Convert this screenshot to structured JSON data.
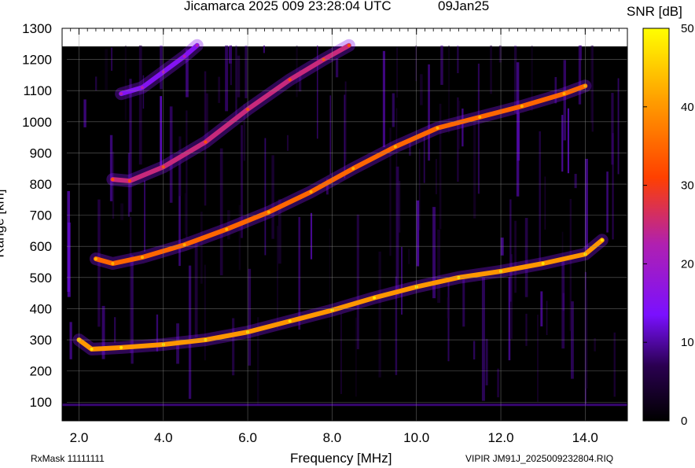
{
  "header": {
    "title": "Jicamarca 2025 009 23:28:04 UTC",
    "date": "09Jan25"
  },
  "footer": {
    "rxmask": "RxMask 11111111",
    "filename": "VIPIR  JM91J_2025009232804.RIQ"
  },
  "colorbar": {
    "label": "SNR [dB]",
    "min": 0,
    "max": 50,
    "ticks": [
      0,
      10,
      20,
      30,
      40,
      50
    ],
    "colors": [
      "#000000",
      "#2a0050",
      "#7a10ff",
      "#b020b0",
      "#ff4000",
      "#ffa000",
      "#ffff00"
    ]
  },
  "chart_data": {
    "type": "heatmap",
    "title": "Jicamarca 2025 009 23:28:04 UTC",
    "xlabel": "Frequency [MHz]",
    "ylabel": "Range [km]",
    "xlim": [
      1.6,
      15.0
    ],
    "ylim": [
      40,
      1300
    ],
    "x_ticks": [
      "2.0",
      "4.0",
      "6.0",
      "8.0",
      "10.0",
      "12.0",
      "14.0"
    ],
    "x_tick_values": [
      2,
      4,
      6,
      8,
      10,
      12,
      14
    ],
    "y_ticks": [
      100,
      200,
      300,
      400,
      500,
      600,
      700,
      800,
      900,
      1000,
      1100,
      1200,
      1300
    ],
    "grid": true,
    "colorscale": "SNR [dB]",
    "traces": [
      {
        "name": "",
        "x": [
          2.0,
          2.3,
          3.0,
          4.0,
          5.0,
          6.0,
          7.0,
          8.0,
          9.0,
          10.0,
          11.0,
          12.0,
          13.0,
          14.0,
          14.4
        ],
        "y": [
          300,
          270,
          275,
          285,
          300,
          325,
          360,
          395,
          435,
          470,
          500,
          520,
          545,
          575,
          620
        ],
        "snr": 40
      },
      {
        "name": "",
        "x": [
          2.4,
          2.8,
          3.5,
          4.5,
          5.5,
          6.5,
          7.5,
          8.5,
          9.5,
          10.5,
          11.5,
          12.5,
          13.5,
          14.0
        ],
        "y": [
          560,
          545,
          565,
          605,
          655,
          710,
          775,
          850,
          920,
          980,
          1015,
          1050,
          1090,
          1115
        ],
        "snr": 35
      },
      {
        "name": "",
        "x": [
          2.8,
          3.2,
          4.0,
          5.0,
          6.0,
          7.0,
          7.8,
          8.4
        ],
        "y": [
          815,
          810,
          855,
          935,
          1040,
          1135,
          1200,
          1245
        ],
        "snr": 25
      },
      {
        "name": "",
        "x": [
          3.0,
          3.5,
          4.0,
          4.5,
          4.8
        ],
        "y": [
          1090,
          1110,
          1160,
          1210,
          1245
        ],
        "snr": 15
      }
    ]
  }
}
